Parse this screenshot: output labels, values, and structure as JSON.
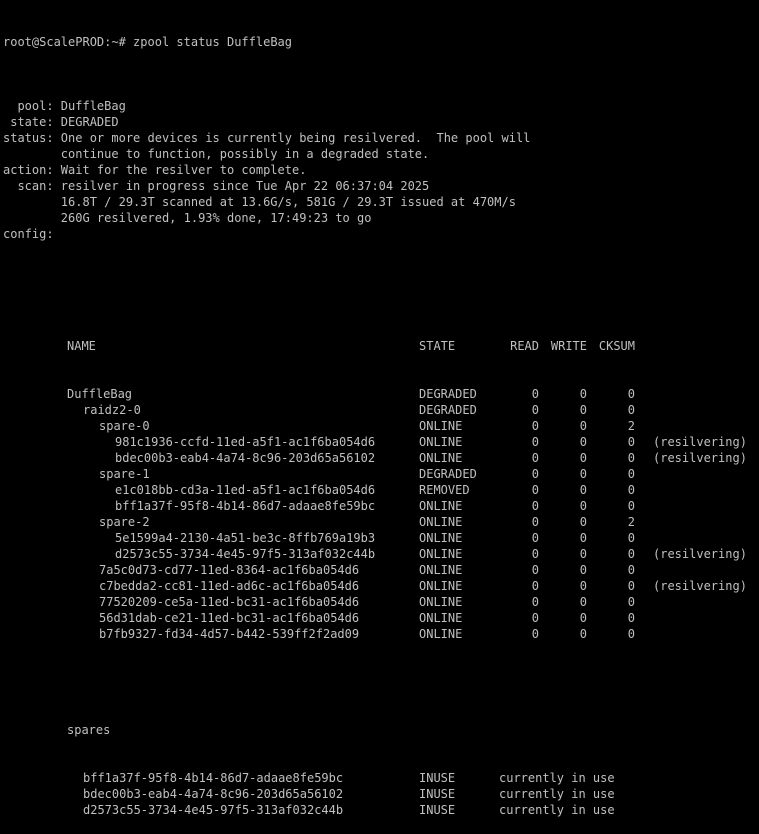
{
  "terminal": {
    "prompt": "root@ScalePROD:~# ",
    "command": "zpool status DuffleBag",
    "header_lines": [
      "  pool: DuffleBag",
      " state: DEGRADED",
      "status: One or more devices is currently being resilvered.  The pool will",
      "        continue to function, possibly in a degraded state.",
      "action: Wait for the resilver to complete.",
      "  scan: resilver in progress since Tue Apr 22 06:37:04 2025",
      "        16.8T / 29.3T scanned at 13.6G/s, 581G / 29.3T issued at 470M/s",
      "        260G resilvered, 1.93% done, 17:49:23 to go",
      "config:",
      ""
    ],
    "columns": {
      "name": "NAME",
      "state": "STATE",
      "read": "READ",
      "write": "WRITE",
      "cksum": "CKSUM"
    },
    "config_rows": [
      {
        "name": "DuffleBag",
        "indent": 0,
        "state": "DEGRADED",
        "read": "0",
        "write": "0",
        "cksum": "0",
        "note": ""
      },
      {
        "name": "raidz2-0",
        "indent": 1,
        "state": "DEGRADED",
        "read": "0",
        "write": "0",
        "cksum": "0",
        "note": ""
      },
      {
        "name": "spare-0",
        "indent": 2,
        "state": "ONLINE",
        "read": "0",
        "write": "0",
        "cksum": "2",
        "note": ""
      },
      {
        "name": "981c1936-ccfd-11ed-a5f1-ac1f6ba054d6",
        "indent": 3,
        "state": "ONLINE",
        "read": "0",
        "write": "0",
        "cksum": "0",
        "note": "(resilvering)"
      },
      {
        "name": "bdec00b3-eab4-4a74-8c96-203d65a56102",
        "indent": 3,
        "state": "ONLINE",
        "read": "0",
        "write": "0",
        "cksum": "0",
        "note": "(resilvering)"
      },
      {
        "name": "spare-1",
        "indent": 2,
        "state": "DEGRADED",
        "read": "0",
        "write": "0",
        "cksum": "0",
        "note": ""
      },
      {
        "name": "e1c018bb-cd3a-11ed-a5f1-ac1f6ba054d6",
        "indent": 3,
        "state": "REMOVED",
        "read": "0",
        "write": "0",
        "cksum": "0",
        "note": ""
      },
      {
        "name": "bff1a37f-95f8-4b14-86d7-adaae8fe59bc",
        "indent": 3,
        "state": "ONLINE",
        "read": "0",
        "write": "0",
        "cksum": "0",
        "note": ""
      },
      {
        "name": "spare-2",
        "indent": 2,
        "state": "ONLINE",
        "read": "0",
        "write": "0",
        "cksum": "2",
        "note": ""
      },
      {
        "name": "5e1599a4-2130-4a51-be3c-8ffb769a19b3",
        "indent": 3,
        "state": "ONLINE",
        "read": "0",
        "write": "0",
        "cksum": "0",
        "note": ""
      },
      {
        "name": "d2573c55-3734-4e45-97f5-313af032c44b",
        "indent": 3,
        "state": "ONLINE",
        "read": "0",
        "write": "0",
        "cksum": "0",
        "note": "(resilvering)"
      },
      {
        "name": "7a5c0d73-cd77-11ed-8364-ac1f6ba054d6",
        "indent": 2,
        "state": "ONLINE",
        "read": "0",
        "write": "0",
        "cksum": "0",
        "note": ""
      },
      {
        "name": "c7bedda2-cc81-11ed-ad6c-ac1f6ba054d6",
        "indent": 2,
        "state": "ONLINE",
        "read": "0",
        "write": "0",
        "cksum": "0",
        "note": "(resilvering)"
      },
      {
        "name": "77520209-ce5a-11ed-bc31-ac1f6ba054d6",
        "indent": 2,
        "state": "ONLINE",
        "read": "0",
        "write": "0",
        "cksum": "0",
        "note": ""
      },
      {
        "name": "56d31dab-ce21-11ed-bc31-ac1f6ba054d6",
        "indent": 2,
        "state": "ONLINE",
        "read": "0",
        "write": "0",
        "cksum": "0",
        "note": ""
      },
      {
        "name": "b7fb9327-fd34-4d57-b442-539ff2f2ad09",
        "indent": 2,
        "state": "ONLINE",
        "read": "0",
        "write": "0",
        "cksum": "0",
        "note": ""
      }
    ],
    "spares_label": "spares",
    "spares": [
      {
        "name": "bff1a37f-95f8-4b14-86d7-adaae8fe59bc",
        "state": "INUSE",
        "note": "currently in use"
      },
      {
        "name": "bdec00b3-eab4-4a74-8c96-203d65a56102",
        "state": "INUSE",
        "note": "currently in use"
      },
      {
        "name": "d2573c55-3734-4e45-97f5-313af032c44b",
        "state": "INUSE",
        "note": "currently in use"
      }
    ],
    "colors": {
      "background": "#000000",
      "foreground": "#c0c0c0"
    }
  }
}
